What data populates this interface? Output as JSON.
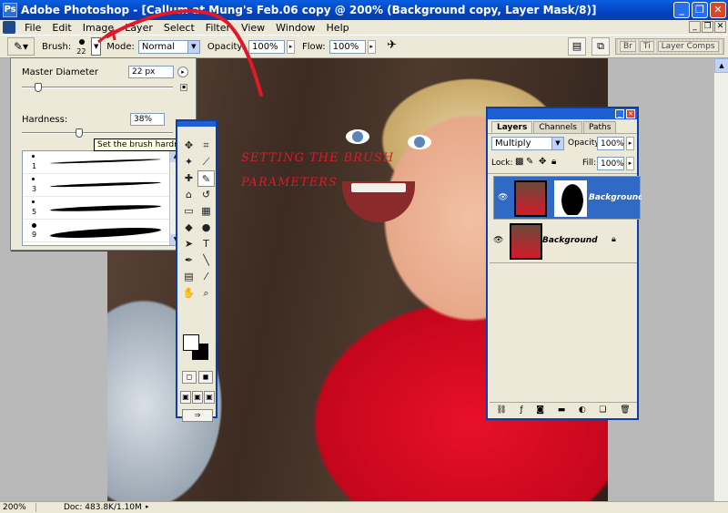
{
  "window": {
    "title": "Adobe Photoshop - [Callum at Mung's Feb.06 copy @ 200% (Background copy, Layer Mask/8)]"
  },
  "menu": [
    "File",
    "Edit",
    "Image",
    "Layer",
    "Select",
    "Filter",
    "View",
    "Window",
    "Help"
  ],
  "options": {
    "brush_label": "Brush:",
    "brush_size": "22",
    "mode_label": "Mode:",
    "mode_value": "Normal",
    "opacity_label": "Opacity:",
    "opacity_value": "100%",
    "flow_label": "Flow:",
    "flow_value": "100%",
    "well_tabs": [
      "Br",
      "Ti",
      "Layer Comps"
    ]
  },
  "brush_popup": {
    "master_diameter_label": "Master Diameter",
    "master_diameter_value": "22 px",
    "hardness_label": "Hardness:",
    "hardness_value": "38%",
    "master_diameter_fraction": 0.11,
    "hardness_fraction": 0.38,
    "tooltip": "Set the brush hardness",
    "brushes": [
      {
        "size": "1"
      },
      {
        "size": "3"
      },
      {
        "size": "5"
      },
      {
        "size": "9"
      }
    ]
  },
  "annotation": {
    "line1": "SETTING THE BRUSH",
    "line2": "PARAMETERS",
    "color": "#e0182a"
  },
  "layers_panel": {
    "tabs": [
      "Layers",
      "Channels",
      "Paths"
    ],
    "blend_mode": "Multiply",
    "opacity_label": "Opacity:",
    "opacity_value": "100%",
    "lock_label": "Lock:",
    "fill_label": "Fill:",
    "fill_value": "100%",
    "layers": [
      {
        "name": "Background copy",
        "selected": true
      },
      {
        "name": "Background",
        "selected": false
      }
    ]
  },
  "status": {
    "zoom": "200%",
    "doc": "Doc: 483.8K/1.10M"
  },
  "colors": {
    "titlebar": "#0143c2",
    "selection": "#316ac5",
    "panel": "#ece9d8"
  }
}
